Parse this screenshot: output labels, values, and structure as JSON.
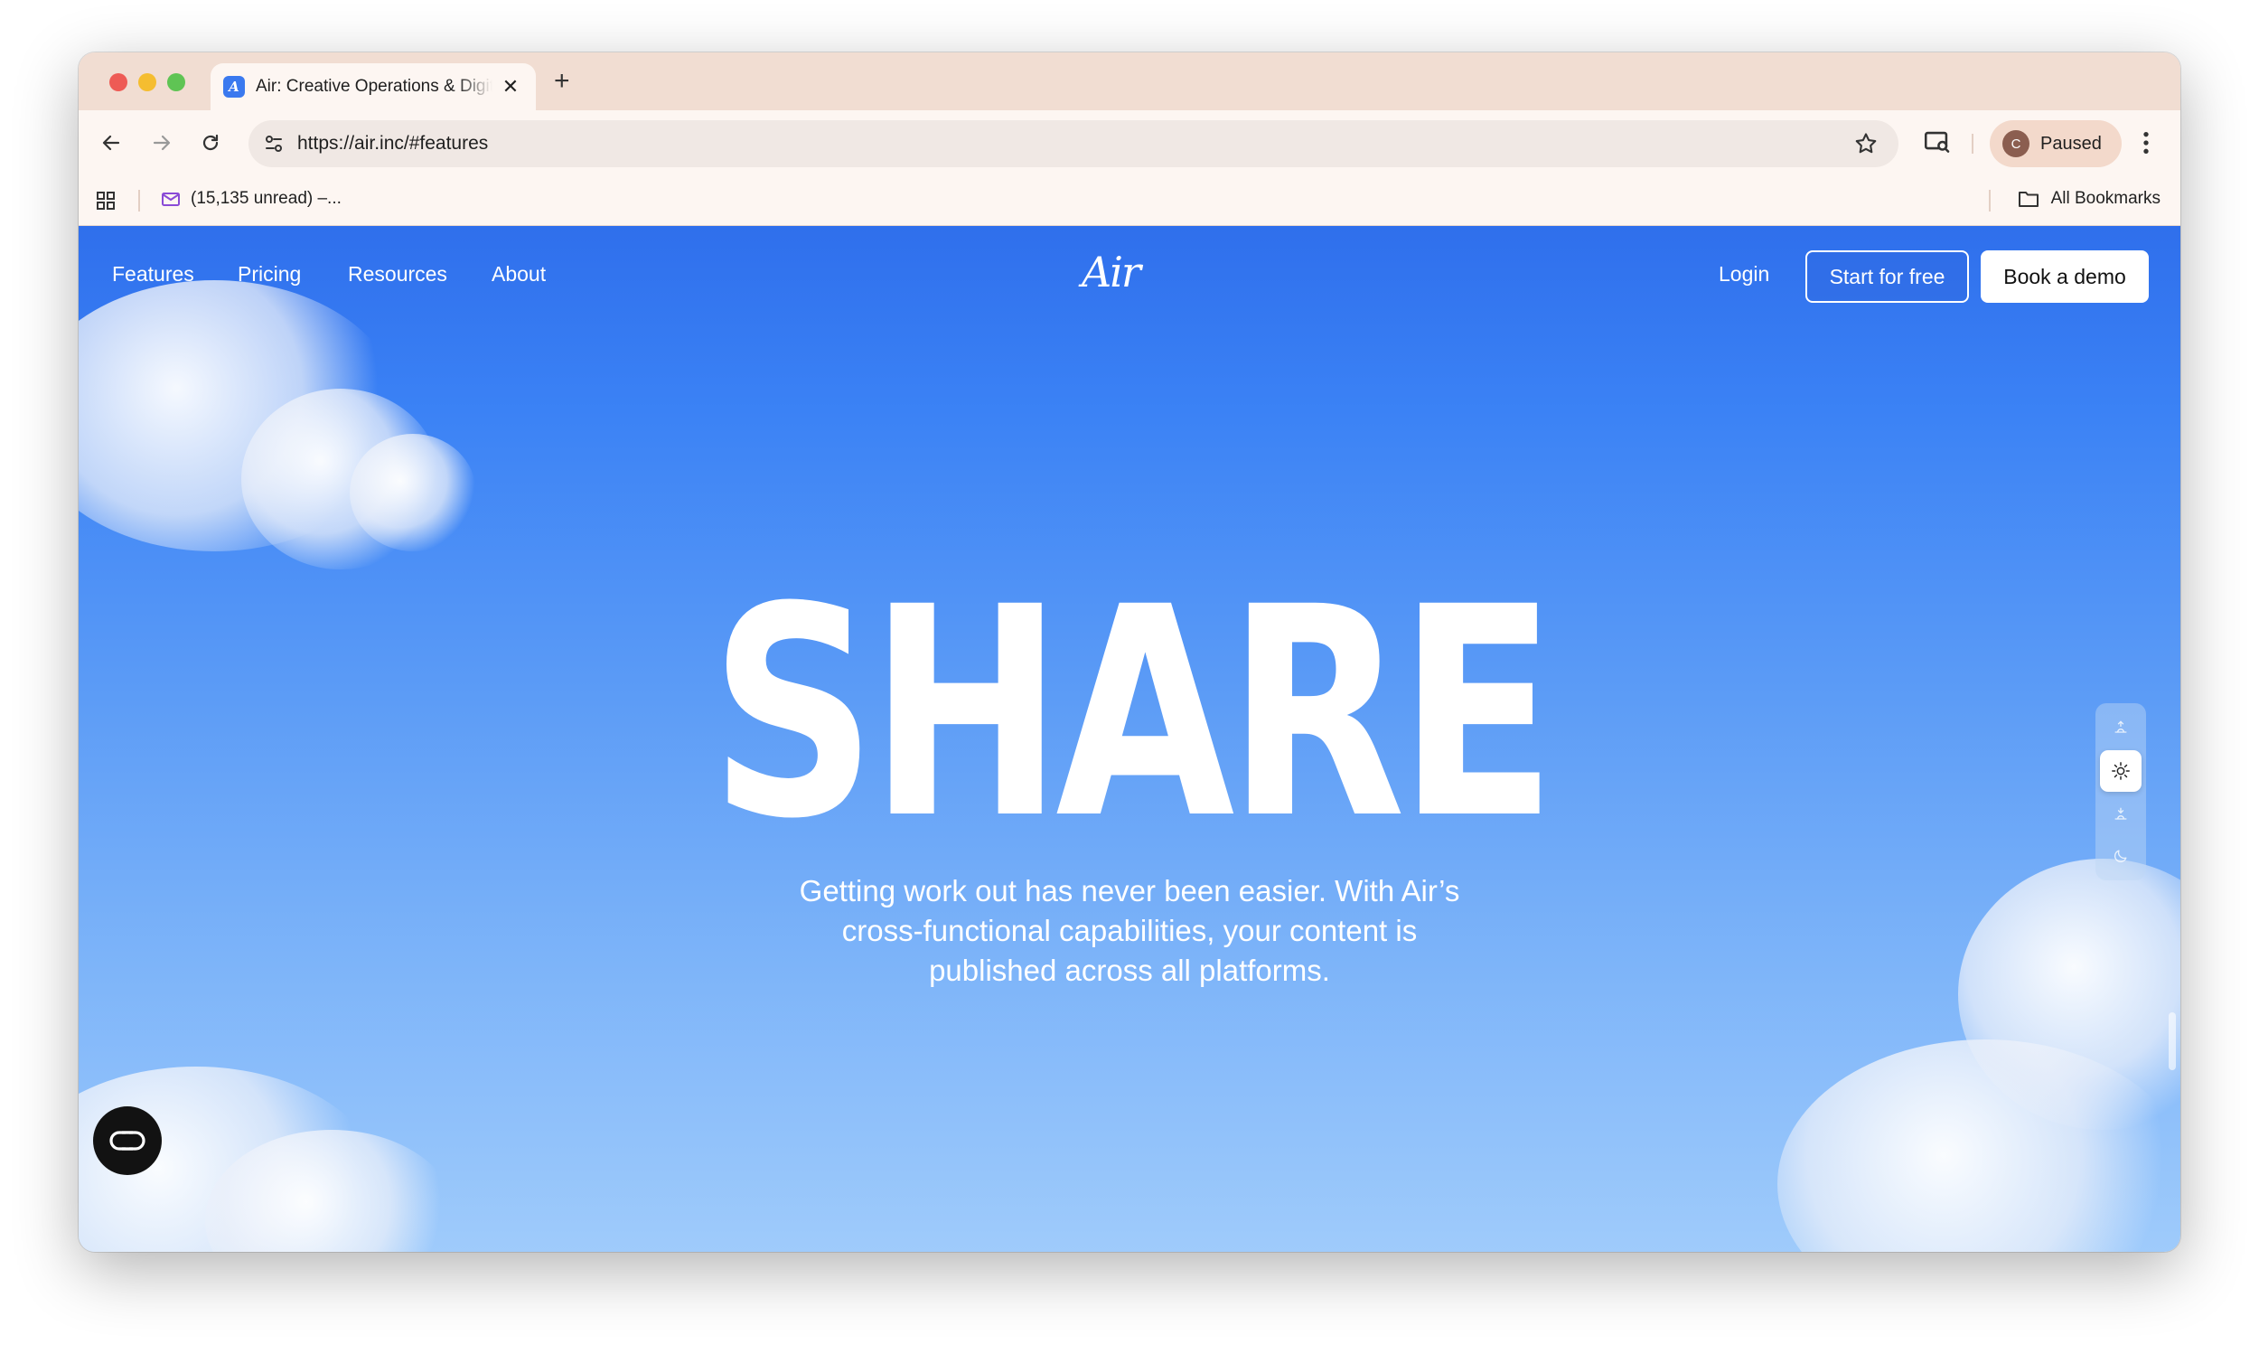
{
  "browser": {
    "tab_title": "Air: Creative Operations & Digital Asset Management",
    "tab_favicon_letter": "A",
    "url": "https://air.inc/#features",
    "profile_initial": "C",
    "profile_status": "Paused",
    "bookmark_item": "(15,135 unread) –...",
    "all_bookmarks": "All Bookmarks"
  },
  "site": {
    "nav": {
      "features": "Features",
      "pricing": "Pricing",
      "resources": "Resources",
      "about": "About"
    },
    "logo": "Air",
    "login": "Login",
    "start_free": "Start for free",
    "book_demo": "Book a demo"
  },
  "hero": {
    "headline": "SHARE",
    "subcopy": "Getting work out has never been easier. With Air’s cross-functional capabilities, your content is published across all platforms."
  },
  "colors": {
    "sky_top": "#2f6fec",
    "sky_bottom": "#9fcbfb",
    "tabstrip": "#f1ddd2"
  }
}
